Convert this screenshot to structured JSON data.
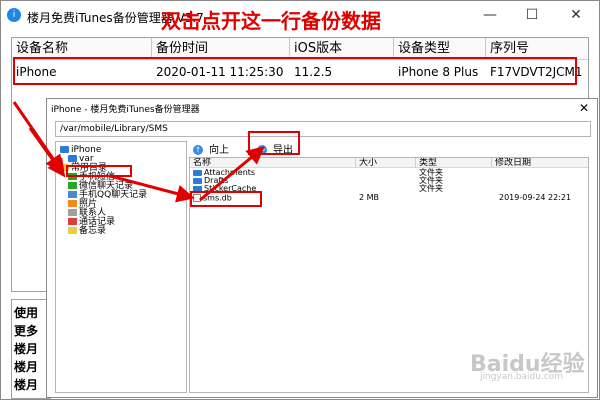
{
  "outer_window": {
    "app_icon_glyph": "i",
    "title": "楼月免费iTunes备份管理器 V3.7",
    "annotation": "双击点开这一行备份数据",
    "window_buttons": {
      "minimize": "—",
      "maximize": "☐",
      "close": "✕"
    }
  },
  "backup_table": {
    "columns": [
      "设备名称",
      "备份时间",
      "iOS版本",
      "设备类型",
      "序列号"
    ],
    "rows": [
      {
        "device_name": "iPhone",
        "backup_time": "2020-01-11 11:25:30",
        "ios_version": "11.2.5",
        "device_type": "iPhone 8 Plus",
        "serial": "F17VDVT2JCM1"
      }
    ]
  },
  "log_panel": {
    "lines": [
      "使用",
      "更多",
      "楼月",
      "楼月",
      "楼月"
    ]
  },
  "inner_window": {
    "title": "iPhone - 楼月免费iTunes备份管理器",
    "close": "✕",
    "path": "/var/mobile/Library/SMS",
    "tree": [
      {
        "label": "iPhone",
        "icon": "folder-blue-icon"
      },
      {
        "label": "var",
        "icon": "folder-blue-icon"
      },
      {
        "label": "常用目录",
        "icon": "folder-yellow-icon"
      },
      {
        "label": "手机短信",
        "icon": "sms-icon"
      },
      {
        "label": "微信聊天记录",
        "icon": "wechat-icon"
      },
      {
        "label": "手机QQ聊天记录",
        "icon": "qq-icon"
      },
      {
        "label": "照片",
        "icon": "photo-icon"
      },
      {
        "label": "联系人",
        "icon": "contacts-icon"
      },
      {
        "label": "通话记录",
        "icon": "call-log-icon"
      },
      {
        "label": "备忘录",
        "icon": "notes-icon"
      }
    ],
    "toolbar": {
      "up_label": "向上",
      "export_label": "导出",
      "up_icon_glyph": "↑",
      "export_icon_glyph": "⇒"
    },
    "file_columns": [
      "名称",
      "大小",
      "类型",
      "修改日期"
    ],
    "files": [
      {
        "name": "Attachments",
        "size": "",
        "type": "文件夹",
        "modified": ""
      },
      {
        "name": "Drafts",
        "size": "",
        "type": "文件夹",
        "modified": ""
      },
      {
        "name": "StickerCache",
        "size": "",
        "type": "文件夹",
        "modified": ""
      },
      {
        "name": "sms.db",
        "size": "2 MB",
        "type": "",
        "modified": "2019-09-24 22:21"
      }
    ]
  },
  "watermark": {
    "text": "Baidu经验",
    "sub": "jingyan.baidu.com"
  },
  "colors": {
    "highlight_red": "#e00000",
    "folder_blue": "#2e7bd6"
  }
}
